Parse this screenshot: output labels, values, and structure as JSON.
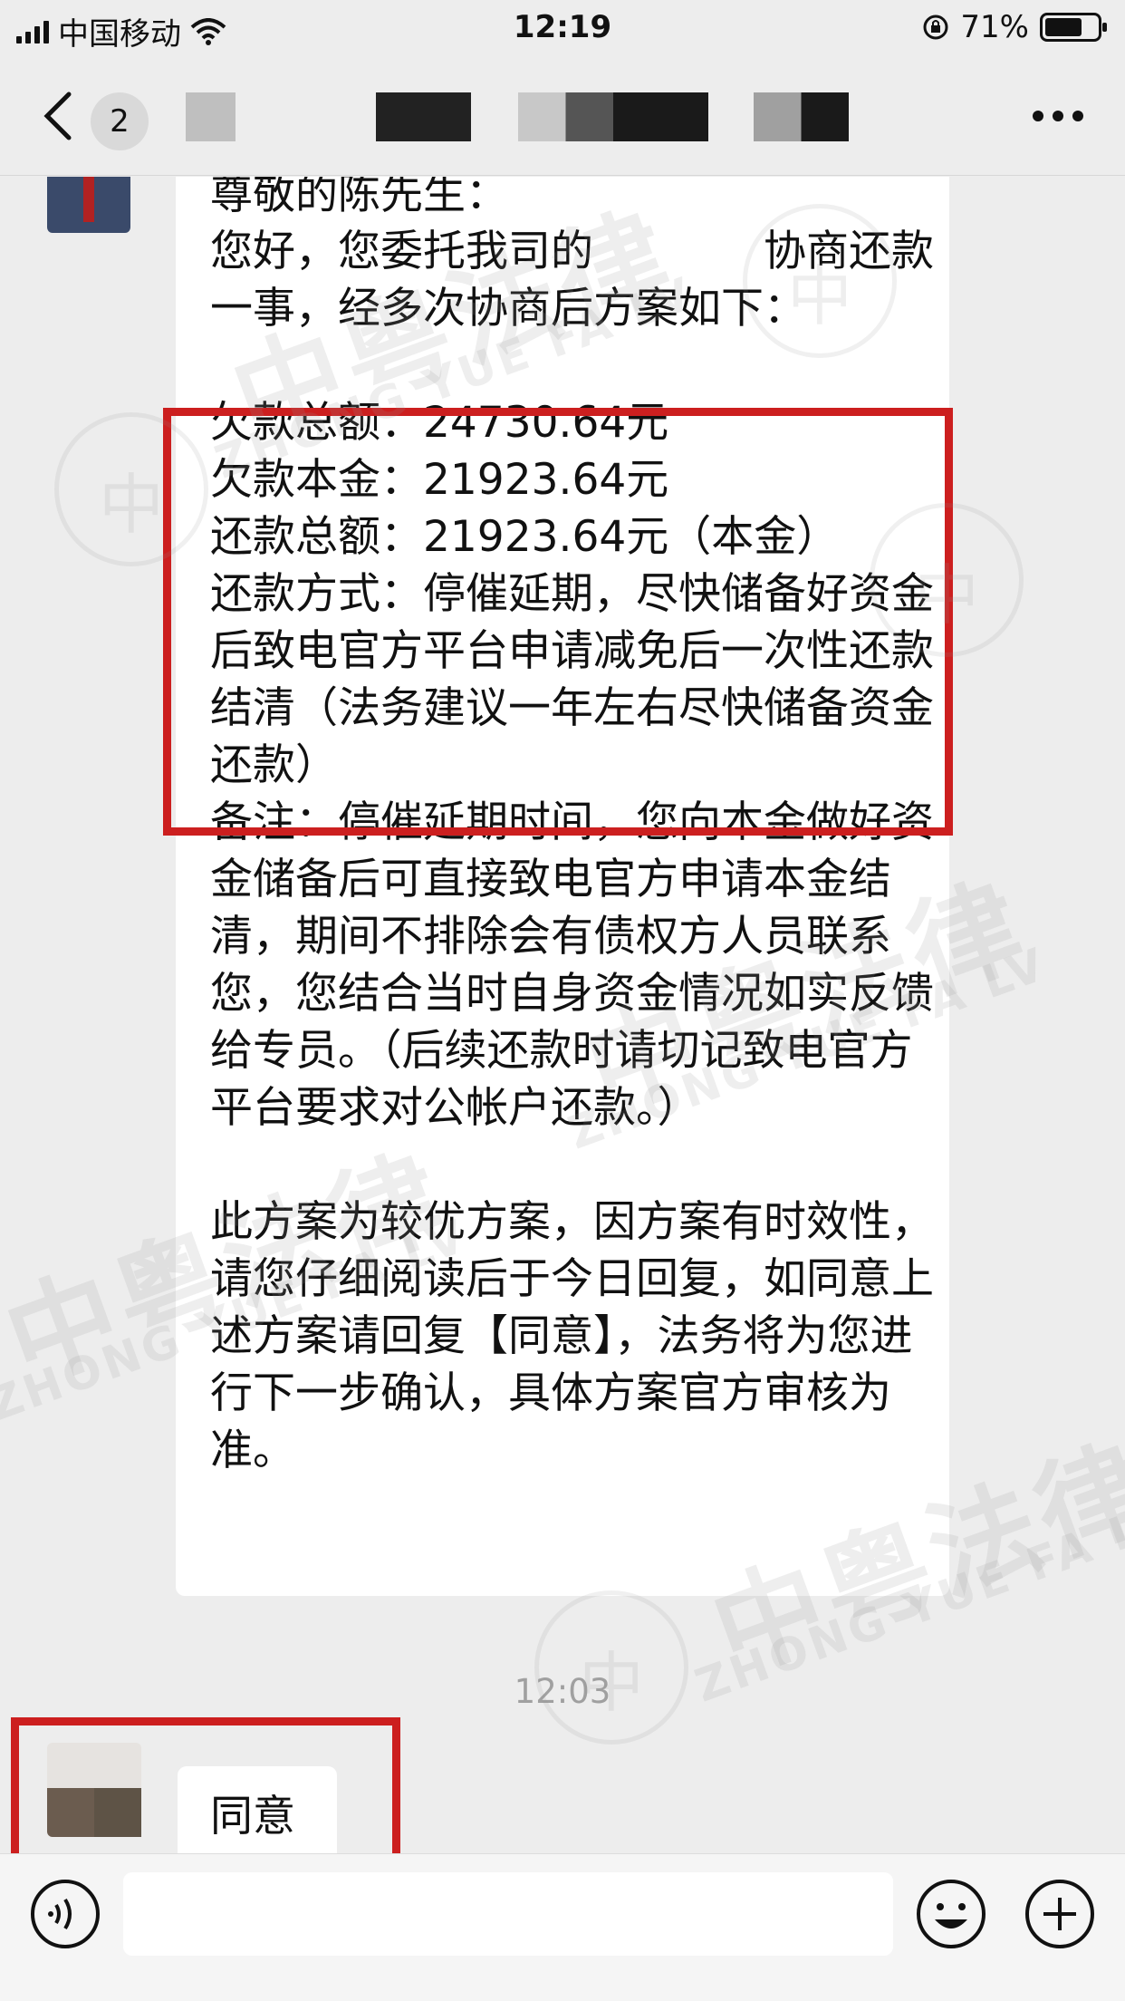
{
  "status_bar": {
    "carrier": "中国移动",
    "time": "12:19",
    "battery": "71%",
    "battery_level": 0.71
  },
  "nav": {
    "unread_count": "2"
  },
  "messages": {
    "incoming": {
      "text": "尊敬的陈先生：\n您好，您委托我司的　　　　协商还款一事，经多次协商后方案如下：\n\n欠款总额：24730.64元\n欠款本金：21923.64元\n还款总额：21923.64元（本金）\n还款方式：停催延期，尽快储备好资金后致电官方平台申请减免后一次性还款结清（法务建议一年左右尽快储备资金还款）\n备注：停催延期时间，您向本金做好资金储备后可直接致电官方申请本金结清，期间不排除会有债权方人员联系您，您结合当时自身资金情况如实反馈给专员。（后续还款时请切记致电官方平台要求对公帐户还款。）\n\n此方案为较优方案，因方案有时效性，请您仔细阅读后于今日回复，如同意上述方案请回复【同意】，法务将为您进行下一步确认，具体方案官方审核为准。"
    },
    "timestamp": "12:03",
    "outgoing": {
      "text": "同意"
    }
  },
  "watermark": {
    "chinese": "中粤法律",
    "english": "ZHONG YUE FA LV"
  },
  "colors": {
    "background": "#ededed",
    "highlight_border": "#cc1f1f",
    "bubble": "#ffffff"
  },
  "icons": [
    "back-chevron-icon",
    "more-icon",
    "voice-icon",
    "emoji-icon",
    "plus-icon",
    "wifi-icon",
    "orientation-lock-icon"
  ]
}
